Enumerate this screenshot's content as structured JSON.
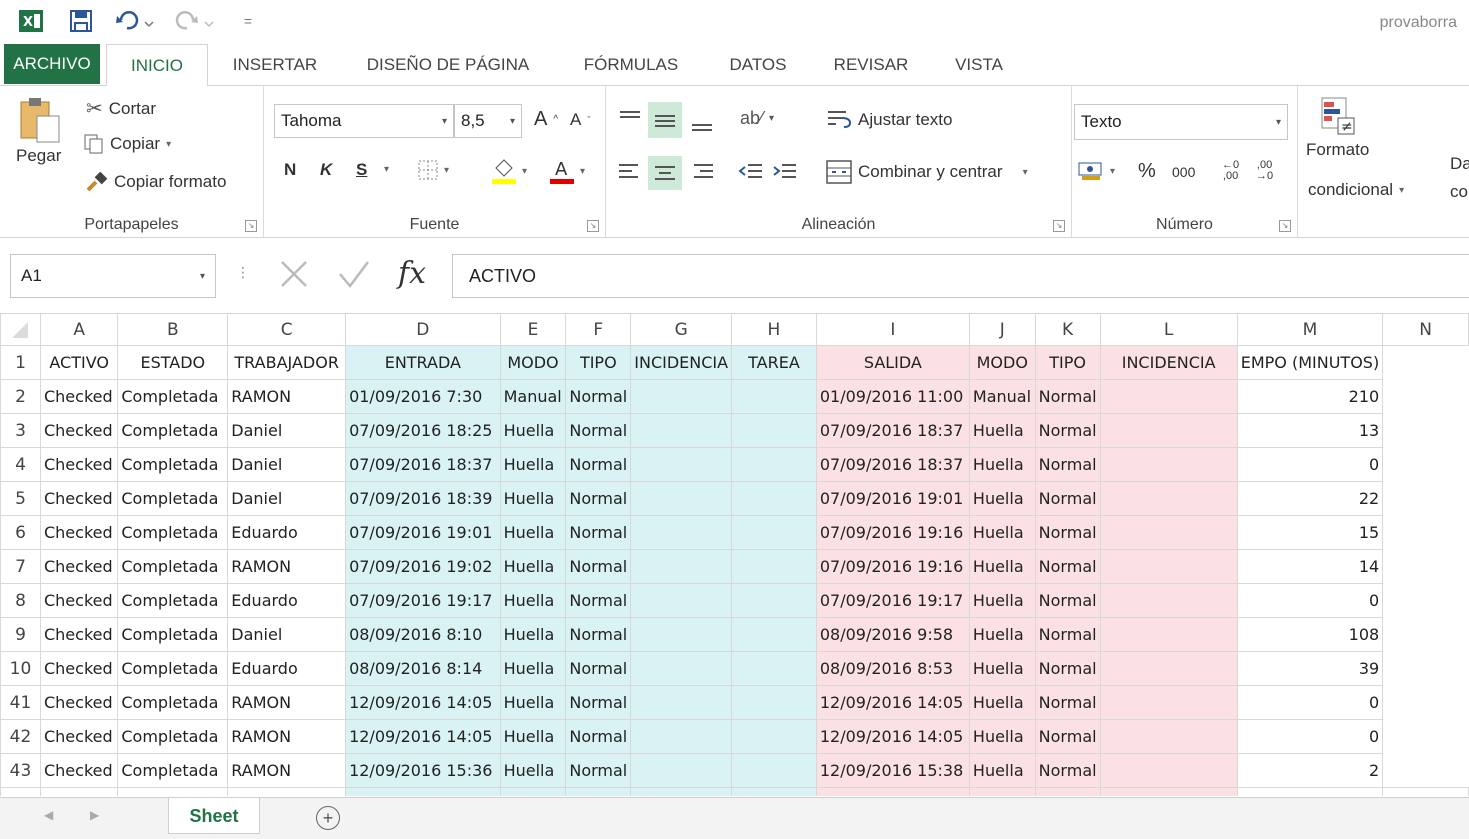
{
  "app": {
    "title": "provaborra"
  },
  "tabs": [
    "ARCHIVO",
    "INICIO",
    "INSERTAR",
    "DISEÑO DE PÁGINA",
    "FÓRMULAS",
    "DATOS",
    "REVISAR",
    "VISTA"
  ],
  "ribbon": {
    "clipboard": {
      "paste": "Pegar",
      "cut": "Cortar",
      "copy": "Copiar",
      "format_painter": "Copiar formato",
      "label": "Portapapeles"
    },
    "font": {
      "name": "Tahoma",
      "size": "8,5",
      "bold": "N",
      "italic": "K",
      "underline": "S",
      "label": "Fuente"
    },
    "alignment": {
      "wrap": "Ajustar texto",
      "merge": "Combinar y centrar",
      "label": "Alineación"
    },
    "number": {
      "format": "Texto",
      "percent": "%",
      "thousands": "000",
      "label": "Número"
    },
    "styles": {
      "conditional_1": "Formato",
      "conditional_2": "condicional",
      "next_1": "Da",
      "next_2": "co"
    }
  },
  "formula_bar": {
    "name_box": "A1",
    "fx": "fx",
    "value": "ACTIVO"
  },
  "columns": [
    "A",
    "B",
    "C",
    "D",
    "E",
    "F",
    "G",
    "H",
    "I",
    "J",
    "K",
    "L",
    "M",
    "N"
  ],
  "header_row": {
    "row": "1",
    "cells": [
      "ACTIVO",
      "ESTADO",
      "TRABAJADOR",
      "ENTRADA",
      "MODO",
      "TIPO",
      "INCIDENCIA",
      "TAREA",
      "SALIDA",
      "MODO",
      "TIPO",
      "INCIDENCIA",
      "EMPO (MINUTOS)",
      ""
    ]
  },
  "rows": [
    {
      "row": "2",
      "cells": [
        "Checked",
        "Completada",
        "RAMON",
        "01/09/2016 7:30",
        "Manual",
        "Normal",
        "",
        "",
        "01/09/2016 11:00",
        "Manual",
        "Normal",
        "",
        "210",
        ""
      ]
    },
    {
      "row": "3",
      "cells": [
        "Checked",
        "Completada",
        "Daniel",
        "07/09/2016 18:25",
        "Huella",
        "Normal",
        "",
        "",
        "07/09/2016 18:37",
        "Huella",
        "Normal",
        "",
        "13",
        ""
      ]
    },
    {
      "row": "4",
      "cells": [
        "Checked",
        "Completada",
        "Daniel",
        "07/09/2016 18:37",
        "Huella",
        "Normal",
        "",
        "",
        "07/09/2016 18:37",
        "Huella",
        "Normal",
        "",
        "0",
        ""
      ]
    },
    {
      "row": "5",
      "cells": [
        "Checked",
        "Completada",
        "Daniel",
        "07/09/2016 18:39",
        "Huella",
        "Normal",
        "",
        "",
        "07/09/2016 19:01",
        "Huella",
        "Normal",
        "",
        "22",
        ""
      ]
    },
    {
      "row": "6",
      "cells": [
        "Checked",
        "Completada",
        "Eduardo",
        "07/09/2016 19:01",
        "Huella",
        "Normal",
        "",
        "",
        "07/09/2016 19:16",
        "Huella",
        "Normal",
        "",
        "15",
        ""
      ]
    },
    {
      "row": "7",
      "cells": [
        "Checked",
        "Completada",
        "RAMON",
        "07/09/2016 19:02",
        "Huella",
        "Normal",
        "",
        "",
        "07/09/2016 19:16",
        "Huella",
        "Normal",
        "",
        "14",
        ""
      ]
    },
    {
      "row": "8",
      "cells": [
        "Checked",
        "Completada",
        "Eduardo",
        "07/09/2016 19:17",
        "Huella",
        "Normal",
        "",
        "",
        "07/09/2016 19:17",
        "Huella",
        "Normal",
        "",
        "0",
        ""
      ]
    },
    {
      "row": "9",
      "cells": [
        "Checked",
        "Completada",
        "Daniel",
        "08/09/2016 8:10",
        "Huella",
        "Normal",
        "",
        "",
        "08/09/2016 9:58",
        "Huella",
        "Normal",
        "",
        "108",
        ""
      ]
    },
    {
      "row": "10",
      "cells": [
        "Checked",
        "Completada",
        "Eduardo",
        "08/09/2016 8:14",
        "Huella",
        "Normal",
        "",
        "",
        "08/09/2016 8:53",
        "Huella",
        "Normal",
        "",
        "39",
        ""
      ]
    },
    {
      "row": "41",
      "cells": [
        "Checked",
        "Completada",
        "RAMON",
        "12/09/2016 14:05",
        "Huella",
        "Normal",
        "",
        "",
        "12/09/2016 14:05",
        "Huella",
        "Normal",
        "",
        "0",
        ""
      ]
    },
    {
      "row": "42",
      "cells": [
        "Checked",
        "Completada",
        "RAMON",
        "12/09/2016 14:05",
        "Huella",
        "Normal",
        "",
        "",
        "12/09/2016 14:05",
        "Huella",
        "Normal",
        "",
        "0",
        ""
      ]
    },
    {
      "row": "43",
      "cells": [
        "Checked",
        "Completada",
        "RAMON",
        "12/09/2016 15:36",
        "Huella",
        "Normal",
        "",
        "",
        "12/09/2016 15:38",
        "Huella",
        "Normal",
        "",
        "2",
        ""
      ]
    }
  ],
  "sheet_tabs": {
    "active": "Sheet",
    "add": "+"
  },
  "colors": {
    "excel_green": "#217346",
    "entry_fill": "#d9f3f5",
    "exit_fill": "#fbe0e4"
  }
}
